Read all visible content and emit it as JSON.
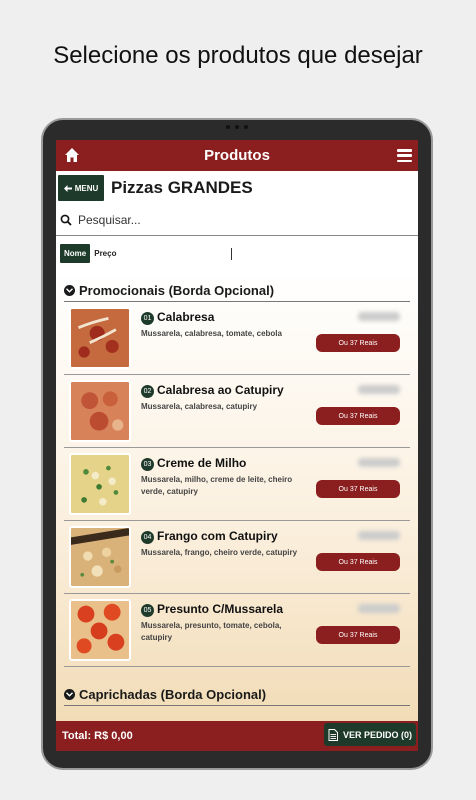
{
  "headline": "Selecione os produtos que desejar",
  "topbar": {
    "title": "Produtos"
  },
  "category": {
    "back_label": "MENU",
    "title": "Pizzas GRANDES"
  },
  "search": {
    "placeholder": "Pesquisar..."
  },
  "sort": {
    "active": "Nome",
    "other": "Preço"
  },
  "sections": [
    {
      "title": "Promocionais (Borda Opcional)",
      "items": [
        {
          "num": "01",
          "name": "Calabresa",
          "desc": "Mussarela, calabresa, tomate, cebola",
          "button": "Ou 37 Reais"
        },
        {
          "num": "02",
          "name": "Calabresa ao Catupiry",
          "desc": "Mussarela, calabresa, catupiry",
          "button": "Ou 37 Reais"
        },
        {
          "num": "03",
          "name": "Creme de Milho",
          "desc": "Mussarela, milho, creme de leite, cheiro verde, catupiry",
          "button": "Ou 37 Reais"
        },
        {
          "num": "04",
          "name": "Frango com Catupiry",
          "desc": "Mussarela, frango, cheiro verde, catupiry",
          "button": "Ou 37 Reais"
        },
        {
          "num": "05",
          "name": "Presunto C/Mussarela",
          "desc": "Mussarela, presunto, tomate, cebola, catupiry",
          "button": "Ou 37 Reais"
        }
      ]
    },
    {
      "title": "Caprichadas (Borda Opcional)"
    }
  ],
  "footer": {
    "total": "Total: R$ 0,00",
    "ver_pedido": "VER PEDIDO (0)"
  },
  "colors": {
    "accent": "#8b1e1e",
    "dark_green": "#1e3a2a"
  }
}
